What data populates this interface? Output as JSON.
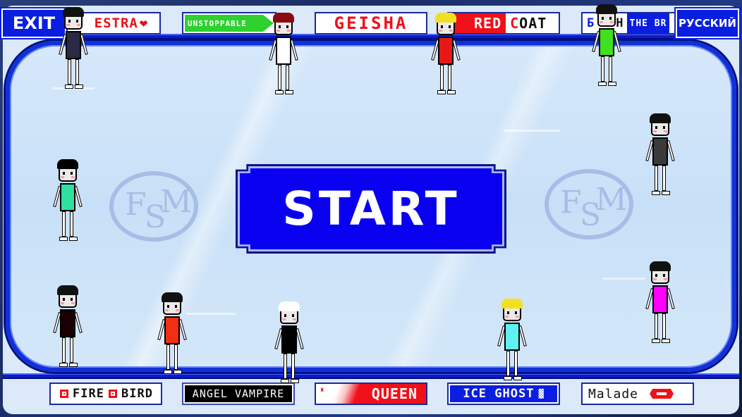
{
  "header": {
    "exit_label": "EXIT",
    "language_label": "РУССКИЙ"
  },
  "top_programs": [
    {
      "id": "estra",
      "label": "ESTRA",
      "suffix_icon": "heart-icon",
      "color": "#e8101a"
    },
    {
      "id": "unstoppable",
      "label": "UNSTOPPABLE",
      "color": "#2ed12e"
    },
    {
      "id": "geisha",
      "label": "GEISHA",
      "color": "#f0101a"
    },
    {
      "id": "red-coat",
      "label_a": "RED",
      "label_b_first": "C",
      "label_b_rest": "OAT",
      "color": "#f0101a"
    },
    {
      "id": "bistro",
      "label_a": "Б",
      "label_b": "H",
      "label_c": "THE BR",
      "color": "#0a1ee0"
    }
  ],
  "bottom_programs": [
    {
      "id": "fire-bird",
      "label_a": "FIRE",
      "label_b": "BIRD",
      "color": "#f0101a"
    },
    {
      "id": "angel-vampire",
      "label": "ANGEL VAMPIRE",
      "color": "#000000"
    },
    {
      "id": "queen",
      "label": "QUEEN",
      "icon": "crown-icon",
      "color": "#f0101a"
    },
    {
      "id": "ice-ghost",
      "label": "ICE GHOST",
      "color": "#0a1ee0"
    },
    {
      "id": "malade",
      "label": "Malade",
      "icon": "lips-icon",
      "color": "#f0101a"
    }
  ],
  "main": {
    "start_label": "START",
    "logo_text": {
      "f": "F",
      "s": "S",
      "m": "M"
    }
  },
  "skaters": [
    {
      "name": "estra-skater",
      "hair": "#111111",
      "outfit": "#2a2a44"
    },
    {
      "name": "geisha-skater-red-hair",
      "hair": "#8a0a10",
      "outfit": "#ffffff"
    },
    {
      "name": "red-coat-skater",
      "hair": "#f2e020",
      "outfit": "#e81818"
    },
    {
      "name": "bistro-skater-shako",
      "hair": "#111111",
      "outfit": "#40e020"
    },
    {
      "name": "back-facing-skater",
      "hair": "#000000",
      "outfit": "#30e0a0"
    },
    {
      "name": "plaid-skater",
      "hair": "#111111",
      "outfit": "#3a3a3a"
    },
    {
      "name": "magenta-skater",
      "hair": "#111111",
      "outfit": "#ff00ff"
    },
    {
      "name": "vampire-skater",
      "hair": "#111111",
      "outfit": "#1a0000"
    },
    {
      "name": "fire-bird-skater",
      "hair": "#111111",
      "outfit": "#f03010"
    },
    {
      "name": "black-white-skater",
      "hair": "#ffffff",
      "outfit": "#000000"
    },
    {
      "name": "ice-ghost-skater",
      "hair": "#f2e020",
      "outfit": "#60f0f0"
    }
  ],
  "colors": {
    "frame_blue": "#0a1ee0",
    "ice": "#d0e4f8",
    "logo": "#a8bde6"
  }
}
